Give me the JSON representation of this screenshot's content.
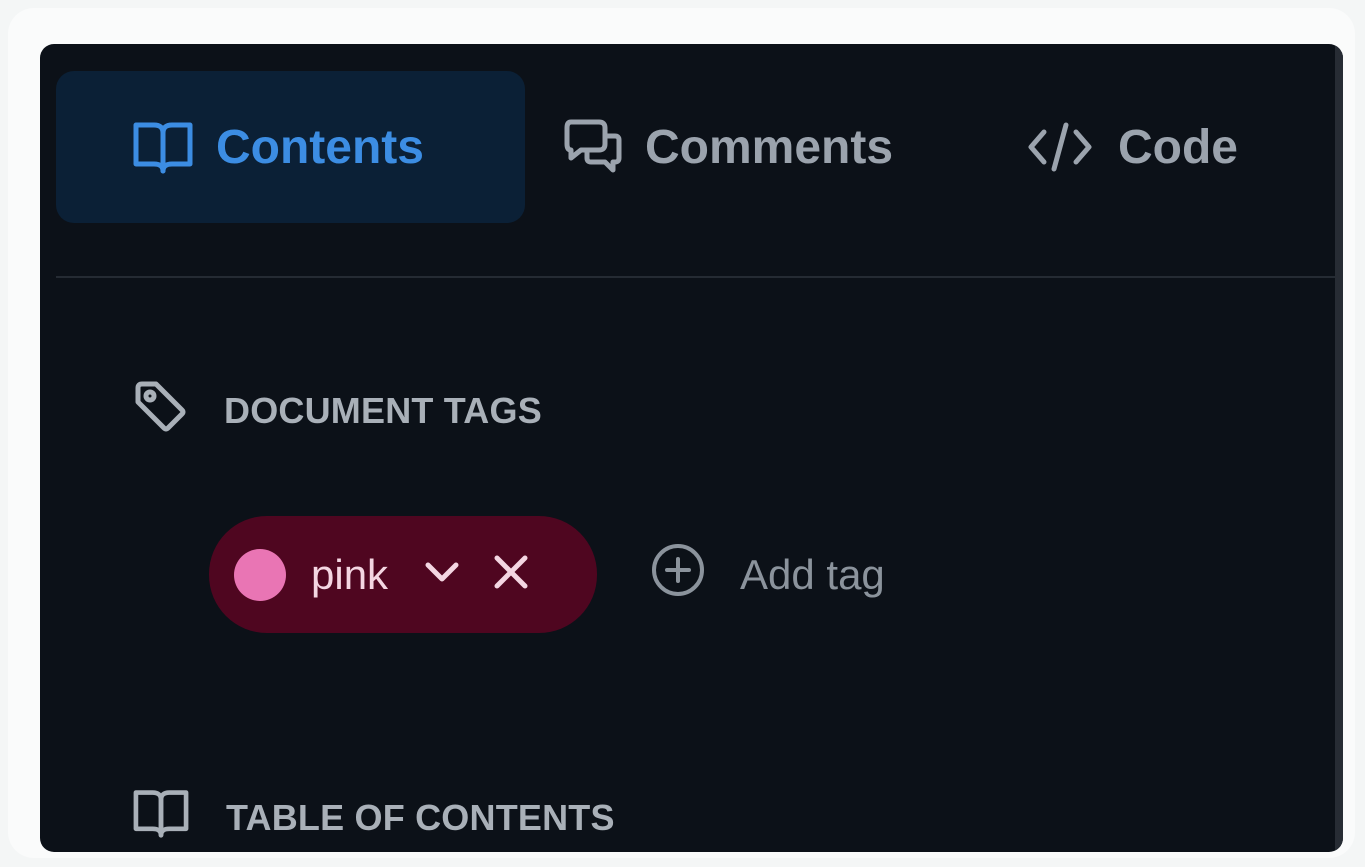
{
  "tabs": [
    {
      "label": "Contents",
      "icon": "book-icon",
      "active": true
    },
    {
      "label": "Comments",
      "icon": "comments-icon",
      "active": false
    },
    {
      "label": "Code",
      "icon": "code-icon",
      "active": false
    }
  ],
  "sections": {
    "tags": {
      "heading": "DOCUMENT TAGS",
      "icon": "tag-icon"
    },
    "toc": {
      "heading": "TABLE OF CONTENTS",
      "icon": "book-icon"
    }
  },
  "tags": [
    {
      "name": "pink",
      "color": "#e975b4"
    }
  ],
  "add_tag_label": "Add tag",
  "colors": {
    "panel_bg": "#0c1118",
    "active_tab_bg": "#0b2036",
    "accent": "#3c8de3",
    "tag_chip_bg": "#4f0620"
  }
}
